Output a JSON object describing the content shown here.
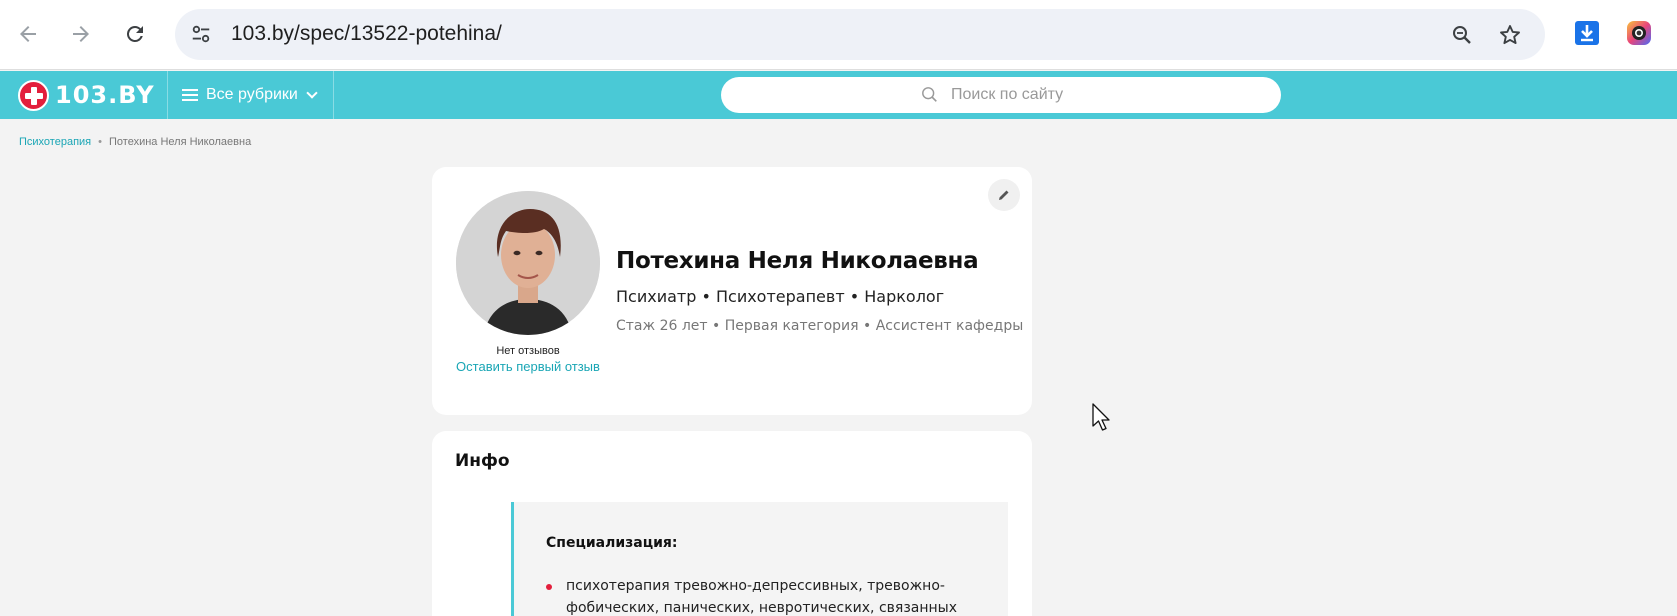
{
  "browser": {
    "url": "103.by/spec/13522-potehina/"
  },
  "site": {
    "logo_text": "103.BY",
    "rubrics_label": "Все рубрики",
    "search_placeholder": "Поиск по сайту",
    "accent_color": "#4ac9d6",
    "brand_red": "#e31e3c"
  },
  "breadcrumb": {
    "parent": "Психотерапия",
    "current": "Потехина Неля Николаевна"
  },
  "profile": {
    "name": "Потехина Неля Николаевна",
    "specialties": "Психиатр • Психотерапевт • Нарколог",
    "meta": "Стаж 26 лет  •  Первая категория • Ассистент кафедры",
    "reviews_status": "Нет отзывов",
    "reviews_link": "Оставить первый отзыв"
  },
  "info": {
    "title": "Инфо",
    "specialization_heading": "Специализация:",
    "specialization_item": "психотерапия тревожно-депрессивных, тревожно-фобических, панических, невротических, связанных со"
  }
}
